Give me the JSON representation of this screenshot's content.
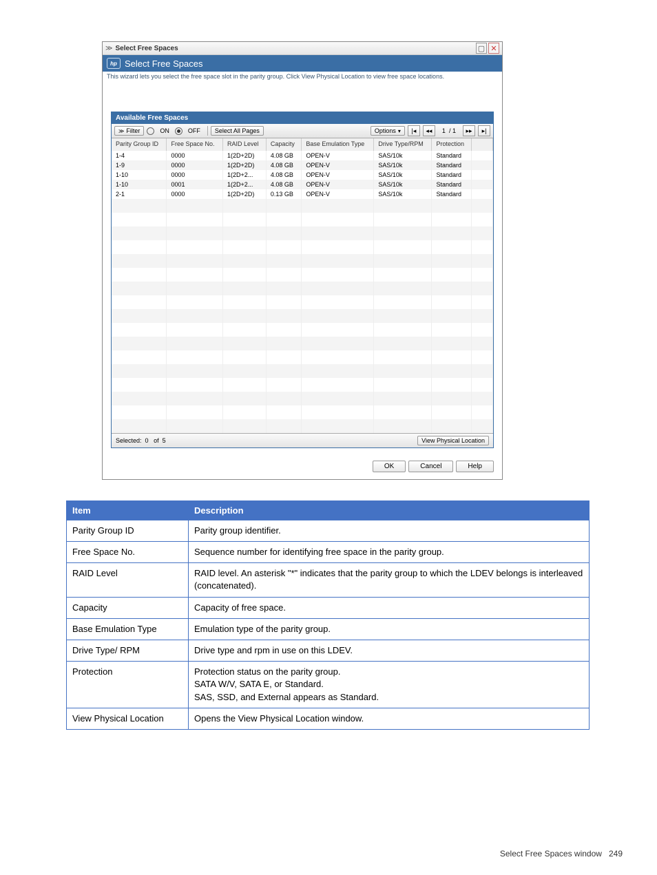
{
  "window": {
    "title": "Select Free Spaces",
    "header_title": "Select Free Spaces",
    "description": "This wizard lets you select the free space slot in the parity group. Click View Physical Location to view free space locations."
  },
  "panel": {
    "title": "Available Free Spaces",
    "filter_label": "Filter",
    "filter_on": "ON",
    "filter_off": "OFF",
    "select_all_label": "Select All Pages",
    "options_label": "Options",
    "page_current": "1",
    "page_sep": "/",
    "page_total": "1",
    "columns": {
      "c0": "Parity Group ID",
      "c1": "Free Space No.",
      "c2": "RAID Level",
      "c3": "Capacity",
      "c4": "Base Emulation Type",
      "c5": "Drive Type/RPM",
      "c6": "Protection"
    },
    "rows": [
      {
        "c0": "1-4",
        "c1": "0000",
        "c2": "1(2D+2D)",
        "c3": "4.08 GB",
        "c4": "OPEN-V",
        "c5": "SAS/10k",
        "c6": "Standard"
      },
      {
        "c0": "1-9",
        "c1": "0000",
        "c2": "1(2D+2D)",
        "c3": "4.08 GB",
        "c4": "OPEN-V",
        "c5": "SAS/10k",
        "c6": "Standard"
      },
      {
        "c0": "1-10",
        "c1": "0000",
        "c2": "1(2D+2...",
        "c3": "4.08 GB",
        "c4": "OPEN-V",
        "c5": "SAS/10k",
        "c6": "Standard"
      },
      {
        "c0": "1-10",
        "c1": "0001",
        "c2": "1(2D+2...",
        "c3": "4.08 GB",
        "c4": "OPEN-V",
        "c5": "SAS/10k",
        "c6": "Standard"
      },
      {
        "c0": "2-1",
        "c1": "0000",
        "c2": "1(2D+2D)",
        "c3": "0.13 GB",
        "c4": "OPEN-V",
        "c5": "SAS/10k",
        "c6": "Standard"
      }
    ],
    "selected_label": "Selected:",
    "selected_count": "0",
    "selected_of": "of",
    "selected_total": "5",
    "view_phys_label": "View Physical Location"
  },
  "actions": {
    "ok": "OK",
    "cancel": "Cancel",
    "help": "Help"
  },
  "desc_table": {
    "h0": "Item",
    "h1": "Description",
    "rows": [
      {
        "item": "Parity Group ID",
        "desc": "Parity group identifier."
      },
      {
        "item": "Free Space No.",
        "desc": "Sequence number for identifying free space in the parity group."
      },
      {
        "item": "RAID Level",
        "desc": "RAID level. An asterisk \"*\" indicates that the parity group to which the LDEV belongs is interleaved (concatenated)."
      },
      {
        "item": "Capacity",
        "desc": "Capacity of free space."
      },
      {
        "item": "Base Emulation Type",
        "desc": "Emulation type of the parity group."
      },
      {
        "item": "Drive Type/ RPM",
        "desc": "Drive type and rpm in use on this LDEV."
      },
      {
        "item": "Protection",
        "desc": "Protection status on the parity group.\nSATA W/V, SATA E, or Standard.\nSAS, SSD, and External appears as Standard."
      },
      {
        "item": "View Physical Location",
        "desc": "Opens the View Physical Location window."
      }
    ]
  },
  "footer": {
    "text": "Select Free Spaces window",
    "page": "249"
  }
}
